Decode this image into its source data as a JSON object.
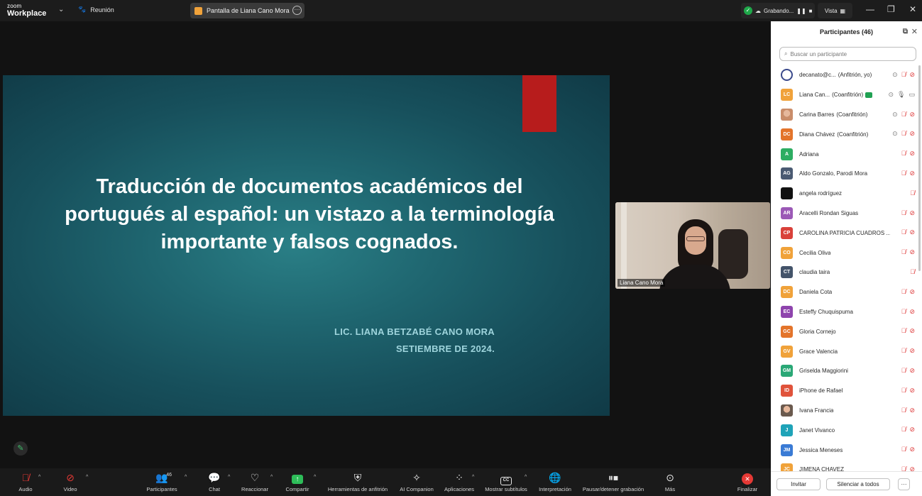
{
  "titlebar": {
    "logo_top": "zoom",
    "logo_bottom": "Workplace",
    "meeting_label": "Reunión",
    "share_tab_label": "Pantalla de Liana Cano Mora",
    "recording_label": "Grabando...",
    "view_label": "Vista",
    "minimize": "—",
    "maximize": "❐",
    "close": "✕"
  },
  "slide": {
    "title": "Traducción de documentos académicos del portugués al español: un vistazo a la terminología importante y falsos cognados.",
    "author": "LIC. LIANA BETZABÉ CANO MORA",
    "date": "SETIEMBRE DE 2024.",
    "accent_color": "#b71c1c"
  },
  "video": {
    "name": "Liana Cano Mora"
  },
  "panel": {
    "title": "Participantes (46)",
    "search_placeholder": "Buscar un participante",
    "participants": [
      {
        "initials": "",
        "name": "decanato@c...",
        "role": "(Anfitrión, yo)",
        "color": "#3b4a8c",
        "avatar": "logo",
        "icons": [
          "rec",
          "mic-off",
          "cam-off"
        ]
      },
      {
        "initials": "LC",
        "name": "Liana Can...",
        "role": "(Coanfitrión)",
        "color": "#f0a23a",
        "avatar": "initials",
        "sharing": true,
        "icons": [
          "rec",
          "mic",
          "cam"
        ]
      },
      {
        "initials": "",
        "name": "Carina Barres",
        "role": "(Coanfitrión)",
        "color": "#c98d6a",
        "avatar": "photo",
        "icons": [
          "rec",
          "mic-off",
          "cam-off"
        ]
      },
      {
        "initials": "DC",
        "name": "Diana Chávez",
        "role": "(Coanfitrión)",
        "color": "#e3742b",
        "avatar": "initials",
        "icons": [
          "rec",
          "mic-off",
          "cam-off"
        ]
      },
      {
        "initials": "A",
        "name": "Adriana",
        "role": "",
        "color": "#2dad62",
        "avatar": "initials",
        "icons": [
          "mic-off",
          "cam-off"
        ]
      },
      {
        "initials": "AG",
        "name": "Aldo Gonzalo, Parodi Mora",
        "role": "",
        "color": "#4a5a72",
        "avatar": "initials",
        "icons": [
          "mic-off",
          "cam-off"
        ]
      },
      {
        "initials": "",
        "name": "angela rodríguez",
        "role": "",
        "color": "#111111",
        "avatar": "initials",
        "icons": [
          "mic-off"
        ]
      },
      {
        "initials": "AR",
        "name": "Aracelli Rondan Siguas",
        "role": "",
        "color": "#9b59b6",
        "avatar": "initials",
        "icons": [
          "mic-off",
          "cam-off"
        ]
      },
      {
        "initials": "CP",
        "name": "CAROLINA PATRICIA CUADROS ...",
        "role": "",
        "color": "#d9413a",
        "avatar": "initials",
        "icons": [
          "mic-off",
          "cam-off"
        ]
      },
      {
        "initials": "CO",
        "name": "Cecilia Oliva",
        "role": "",
        "color": "#f0a23a",
        "avatar": "initials",
        "icons": [
          "mic-off",
          "cam-off"
        ]
      },
      {
        "initials": "CT",
        "name": "claudia taira",
        "role": "",
        "color": "#44546a",
        "avatar": "initials",
        "icons": [
          "mic-off"
        ]
      },
      {
        "initials": "DC",
        "name": "Daniela Cota",
        "role": "",
        "color": "#f0a23a",
        "avatar": "initials",
        "icons": [
          "mic-off",
          "cam-off"
        ]
      },
      {
        "initials": "EC",
        "name": "Esteffy Chuquispuma",
        "role": "",
        "color": "#8e44ad",
        "avatar": "initials",
        "icons": [
          "mic-off",
          "cam-off"
        ]
      },
      {
        "initials": "GC",
        "name": "Gloria Cornejo",
        "role": "",
        "color": "#e3742b",
        "avatar": "initials",
        "icons": [
          "mic-off",
          "cam-off"
        ]
      },
      {
        "initials": "GV",
        "name": "Grace Valencia",
        "role": "",
        "color": "#f0a23a",
        "avatar": "initials",
        "icons": [
          "mic-off",
          "cam-off"
        ]
      },
      {
        "initials": "GM",
        "name": "Griselda Maggiorini",
        "role": "",
        "color": "#2aa876",
        "avatar": "initials",
        "icons": [
          "mic-off",
          "cam-off"
        ]
      },
      {
        "initials": "ID",
        "name": "iPhone de Rafael",
        "role": "",
        "color": "#e0533b",
        "avatar": "initials",
        "icons": [
          "mic-off",
          "cam-off"
        ]
      },
      {
        "initials": "",
        "name": "Ivana Francia",
        "role": "",
        "color": "#6b5a4e",
        "avatar": "photo",
        "icons": [
          "mic-off",
          "cam-off"
        ]
      },
      {
        "initials": "J",
        "name": "Janet Vivanco",
        "role": "",
        "color": "#1fa3b8",
        "avatar": "initials",
        "icons": [
          "mic-off",
          "cam-off"
        ]
      },
      {
        "initials": "JM",
        "name": "Jessica Meneses",
        "role": "",
        "color": "#3a7bd5",
        "avatar": "initials",
        "icons": [
          "mic-off",
          "cam-off"
        ]
      },
      {
        "initials": "JC",
        "name": "JIMENA CHAVEZ",
        "role": "",
        "color": "#f0a23a",
        "avatar": "initials",
        "icons": [
          "mic-off",
          "cam-off"
        ]
      }
    ],
    "invite_label": "Invitar",
    "mute_all_label": "Silenciar a todos",
    "more_label": "···"
  },
  "toolbar": {
    "audio": "Audio",
    "video": "Video",
    "participants": "Participantes",
    "participants_count": "46",
    "chat": "Chat",
    "react": "Reaccionar",
    "share": "Compartir",
    "host_tools": "Herramientas de anfitrión",
    "ai_companion": "AI Companion",
    "apps": "Aplicaciones",
    "captions": "Mostrar subtítulos",
    "interpretation": "Interpretación",
    "pause_recording": "Pausar/detener grabación",
    "more": "Más",
    "end": "Finalizar"
  }
}
